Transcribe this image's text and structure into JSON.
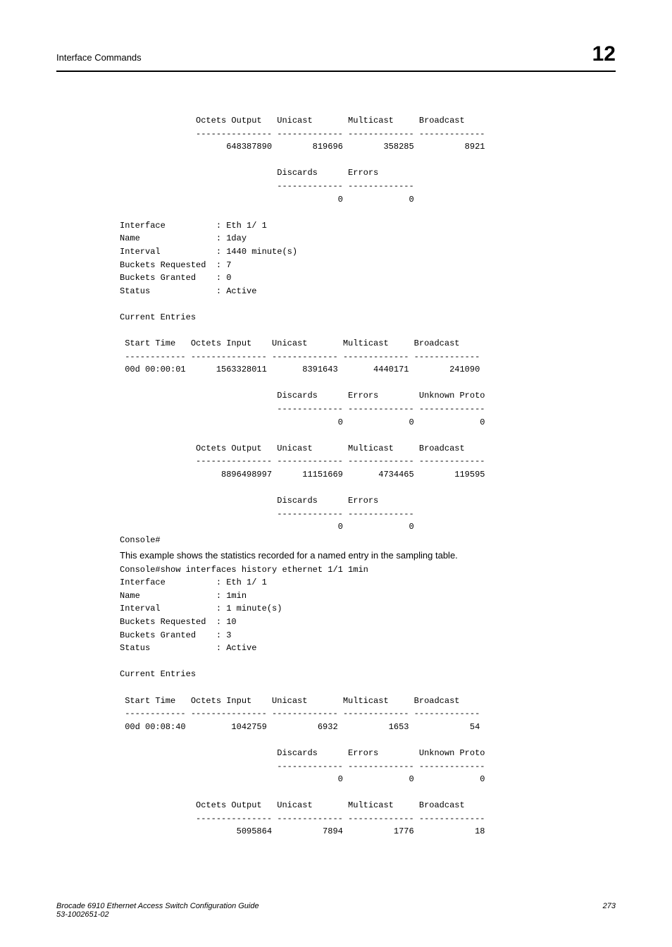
{
  "header": {
    "title": "Interface Commands",
    "chapter": "12"
  },
  "console1": "               Octets Output   Unicast       Multicast     Broadcast\n               --------------- ------------- ------------- -------------\n                     648387890        819696        358285          8921\n\n                               Discards      Errors\n                               ------------- -------------\n                                           0             0\n\nInterface          : Eth 1/ 1\nName               : 1day\nInterval           : 1440 minute(s)\nBuckets Requested  : 7\nBuckets Granted    : 0\nStatus             : Active\n\nCurrent Entries\n\n Start Time   Octets Input    Unicast       Multicast     Broadcast\n ------------ --------------- ------------- ------------- -------------\n 00d 00:00:01      1563328011       8391643       4440171        241090\n\n                               Discards      Errors        Unknown Proto\n                               ------------- ------------- -------------\n                                           0             0             0\n\n               Octets Output   Unicast       Multicast     Broadcast\n               --------------- ------------- ------------- -------------\n                    8896498997      11151669       4734465        119595\n\n                               Discards      Errors\n                               ------------- -------------\n                                           0             0\nConsole#",
  "body_text": "This example shows the statistics recorded for a named entry in the sampling table.",
  "console2": "Console#show interfaces history ethernet 1/1 1min\nInterface          : Eth 1/ 1\nName               : 1min\nInterval           : 1 minute(s)\nBuckets Requested  : 10\nBuckets Granted    : 3\nStatus             : Active\n\nCurrent Entries\n\n Start Time   Octets Input    Unicast       Multicast     Broadcast\n ------------ --------------- ------------- ------------- -------------\n 00d 00:08:40         1042759          6932          1653            54\n\n                               Discards      Errors        Unknown Proto\n                               ------------- ------------- -------------\n                                           0             0             0\n\n               Octets Output   Unicast       Multicast     Broadcast\n               --------------- ------------- ------------- -------------\n                       5095864          7894          1776            18",
  "footer": {
    "left_line1": "Brocade 6910 Ethernet Access Switch Configuration Guide",
    "left_line2": "53-1002651-02",
    "page": "273"
  }
}
